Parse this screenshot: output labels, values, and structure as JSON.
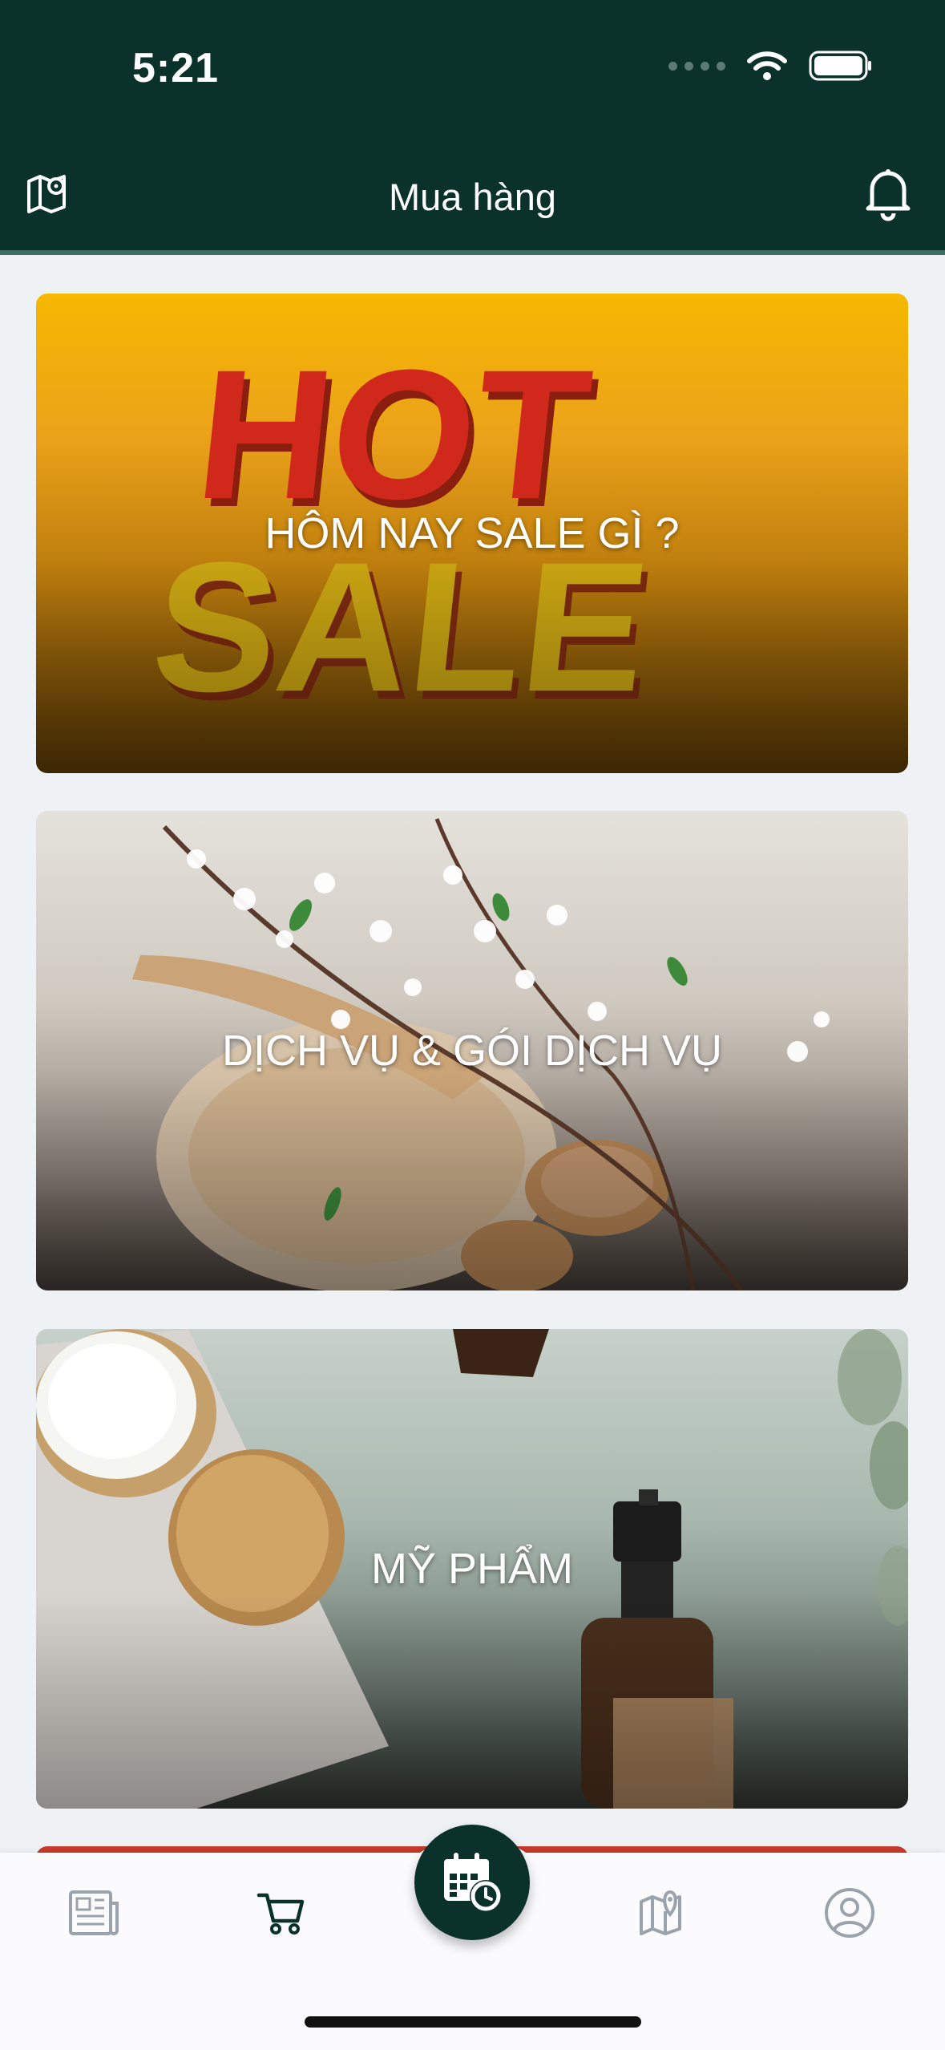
{
  "status_bar": {
    "time": "5:21"
  },
  "header": {
    "title": "Mua hàng"
  },
  "cards": [
    {
      "label": "HÔM NAY SALE GÌ ?",
      "image_text_1": "HOT",
      "image_text_2": "SALE"
    },
    {
      "label": "DỊCH VỤ & GÓI DỊCH VỤ"
    },
    {
      "label": "MỸ PHẨM"
    }
  ],
  "bottom_nav": {
    "items": [
      "news-icon",
      "cart-icon",
      "calendar-clock-icon",
      "map-icon",
      "user-icon"
    ],
    "active": "cart-icon"
  },
  "colors": {
    "header_bg": "#0b312b",
    "page_bg": "#eef2f5",
    "active_icon": "#0b312b",
    "inactive_icon": "#9aa3ab"
  }
}
